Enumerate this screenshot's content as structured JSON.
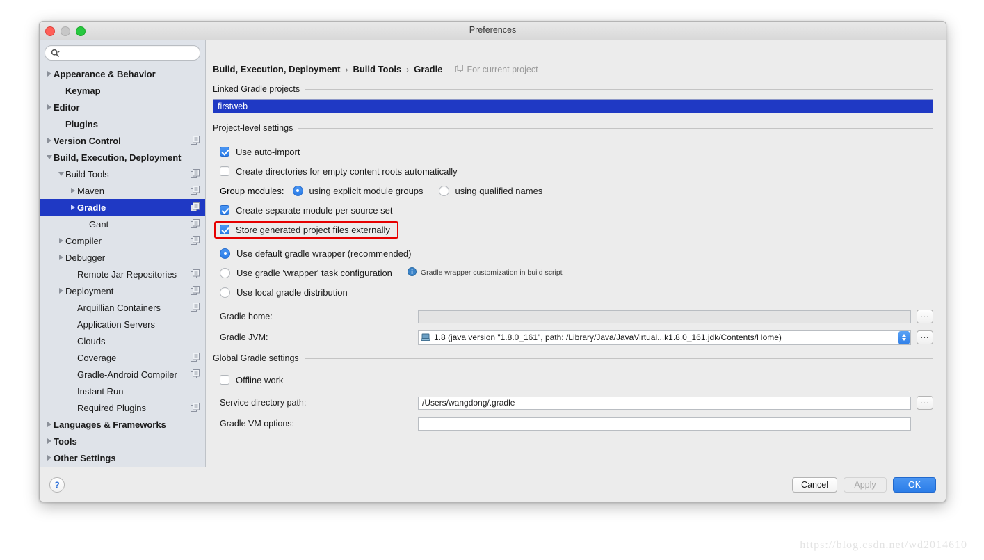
{
  "window": {
    "title": "Preferences",
    "traffic": {
      "close": "close-button",
      "minimize": "minimize-button",
      "zoom": "zoom-button"
    }
  },
  "sidebar": {
    "search": {
      "value": "",
      "placeholder": ""
    },
    "items": [
      {
        "label": "Appearance & Behavior",
        "indent": 0,
        "arrow": "right",
        "bold": true,
        "badge": false,
        "selected": false
      },
      {
        "label": "Keymap",
        "indent": 1,
        "arrow": "none",
        "bold": true,
        "badge": false,
        "selected": false
      },
      {
        "label": "Editor",
        "indent": 0,
        "arrow": "right",
        "bold": true,
        "badge": false,
        "selected": false
      },
      {
        "label": "Plugins",
        "indent": 1,
        "arrow": "none",
        "bold": true,
        "badge": false,
        "selected": false
      },
      {
        "label": "Version Control",
        "indent": 0,
        "arrow": "right",
        "bold": true,
        "badge": true,
        "selected": false
      },
      {
        "label": "Build, Execution, Deployment",
        "indent": 0,
        "arrow": "down",
        "bold": true,
        "badge": false,
        "selected": false
      },
      {
        "label": "Build Tools",
        "indent": 1,
        "arrow": "down",
        "bold": false,
        "badge": true,
        "selected": false
      },
      {
        "label": "Maven",
        "indent": 2,
        "arrow": "right",
        "bold": false,
        "badge": true,
        "selected": false
      },
      {
        "label": "Gradle",
        "indent": 2,
        "arrow": "right",
        "bold": true,
        "badge": true,
        "selected": true
      },
      {
        "label": "Gant",
        "indent": 3,
        "arrow": "none",
        "bold": false,
        "badge": true,
        "selected": false
      },
      {
        "label": "Compiler",
        "indent": 1,
        "arrow": "right",
        "bold": false,
        "badge": true,
        "selected": false
      },
      {
        "label": "Debugger",
        "indent": 1,
        "arrow": "right",
        "bold": false,
        "badge": false,
        "selected": false
      },
      {
        "label": "Remote Jar Repositories",
        "indent": 2,
        "arrow": "none",
        "bold": false,
        "badge": true,
        "selected": false
      },
      {
        "label": "Deployment",
        "indent": 1,
        "arrow": "right",
        "bold": false,
        "badge": true,
        "selected": false
      },
      {
        "label": "Arquillian Containers",
        "indent": 2,
        "arrow": "none",
        "bold": false,
        "badge": true,
        "selected": false
      },
      {
        "label": "Application Servers",
        "indent": 2,
        "arrow": "none",
        "bold": false,
        "badge": false,
        "selected": false
      },
      {
        "label": "Clouds",
        "indent": 2,
        "arrow": "none",
        "bold": false,
        "badge": false,
        "selected": false
      },
      {
        "label": "Coverage",
        "indent": 2,
        "arrow": "none",
        "bold": false,
        "badge": true,
        "selected": false
      },
      {
        "label": "Gradle-Android Compiler",
        "indent": 2,
        "arrow": "none",
        "bold": false,
        "badge": true,
        "selected": false
      },
      {
        "label": "Instant Run",
        "indent": 2,
        "arrow": "none",
        "bold": false,
        "badge": false,
        "selected": false
      },
      {
        "label": "Required Plugins",
        "indent": 2,
        "arrow": "none",
        "bold": false,
        "badge": true,
        "selected": false
      },
      {
        "label": "Languages & Frameworks",
        "indent": 0,
        "arrow": "right",
        "bold": true,
        "badge": false,
        "selected": false
      },
      {
        "label": "Tools",
        "indent": 0,
        "arrow": "right",
        "bold": true,
        "badge": false,
        "selected": false
      },
      {
        "label": "Other Settings",
        "indent": 0,
        "arrow": "right",
        "bold": true,
        "badge": false,
        "selected": false
      }
    ]
  },
  "content": {
    "breadcrumb": [
      "Build, Execution, Deployment",
      "Build Tools",
      "Gradle"
    ],
    "breadcrumb_separator": "›",
    "for_current_project": "For current project",
    "linked_projects": {
      "title": "Linked Gradle projects",
      "items": [
        "firstweb"
      ]
    },
    "project_level": {
      "title": "Project-level settings",
      "use_auto_import": {
        "label": "Use auto-import",
        "checked": true
      },
      "create_dirs": {
        "label": "Create directories for empty content roots automatically",
        "checked": false
      },
      "group_modules": {
        "label": "Group modules:",
        "options": [
          {
            "label": "using explicit module groups",
            "selected": true
          },
          {
            "label": "using qualified names",
            "selected": false
          }
        ]
      },
      "separate_module": {
        "label": "Create separate module per source set",
        "checked": true
      },
      "store_externally": {
        "label": "Store generated project files externally",
        "checked": true,
        "highlighted": true
      }
    },
    "distribution": {
      "options": [
        {
          "label": "Use default gradle wrapper (recommended)",
          "selected": true
        },
        {
          "label": "Use gradle 'wrapper' task configuration",
          "selected": false,
          "note": "Gradle wrapper customization in build script"
        },
        {
          "label": "Use local gradle distribution",
          "selected": false
        }
      ]
    },
    "gradle_home": {
      "label": "Gradle home:",
      "value": "",
      "browse": "..."
    },
    "gradle_jvm": {
      "label": "Gradle JVM:",
      "value": "1.8 (java version \"1.8.0_161\", path: /Library/Java/JavaVirtual...k1.8.0_161.jdk/Contents/Home)",
      "browse": "..."
    },
    "global": {
      "title": "Global Gradle settings",
      "offline_work": {
        "label": "Offline work",
        "checked": false
      },
      "service_dir": {
        "label": "Service directory path:",
        "value": "/Users/wangdong/.gradle",
        "browse": "..."
      },
      "vm_options": {
        "label": "Gradle VM options:",
        "value": ""
      }
    }
  },
  "footer": {
    "help": "?",
    "cancel": "Cancel",
    "apply": "Apply",
    "ok": "OK"
  },
  "watermark": "https://blog.csdn.net/wd2014610",
  "colors": {
    "selection_blue": "#1f39c4",
    "accent_blue": "#2b7de8",
    "highlight_red": "#e60000",
    "sidebar_bg": "#dfe3e9",
    "content_bg": "#ececec"
  }
}
